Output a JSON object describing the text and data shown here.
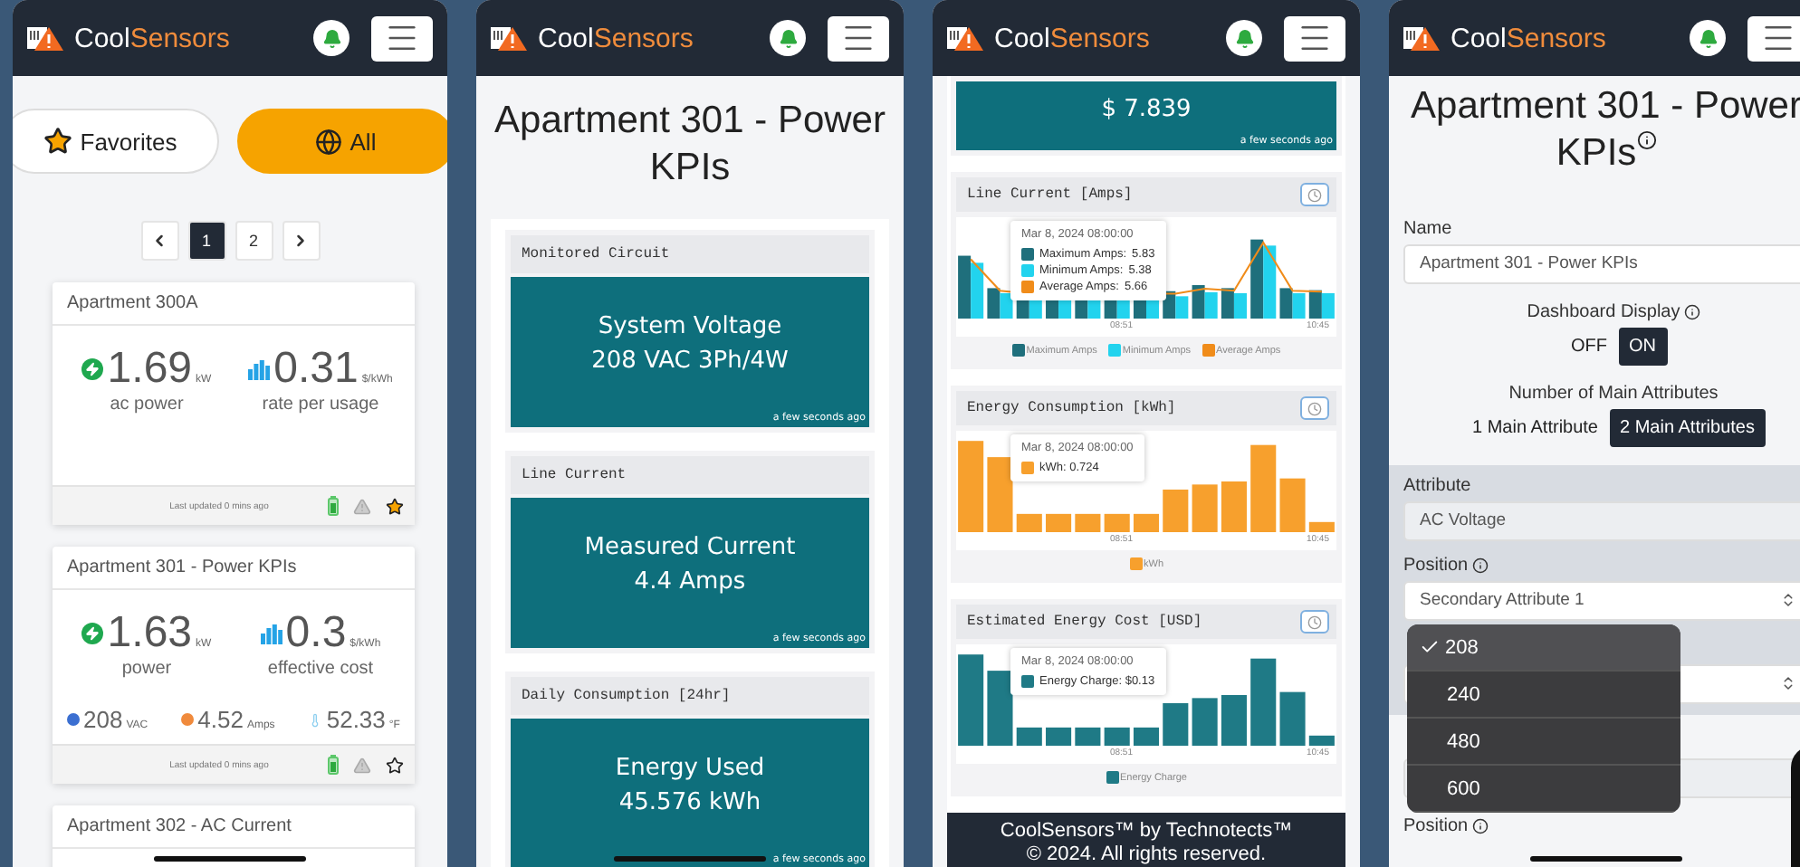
{
  "screens": [
    {
      "kind": "device_list",
      "header": {
        "brand_first": "Cool",
        "brand_second": "Sensors"
      },
      "filters": [
        {
          "label": "Favorites",
          "selected": false
        },
        {
          "label": "All",
          "selected": true
        }
      ],
      "pages": [
        {
          "label": "1",
          "selected": true
        },
        {
          "label": "2",
          "selected": false
        }
      ],
      "cards": [
        {
          "title": "Apartment 300A",
          "metrics": [
            {
              "kind": "power",
              "value": "1.69",
              "unit": "kW",
              "label": "ac power"
            },
            {
              "kind": "rate",
              "value": "0.31",
              "unit": "$/kWh",
              "label": "rate per usage"
            }
          ],
          "updated": "Last updated 0 mins ago",
          "favorite": true
        },
        {
          "title": "Apartment 301 - Power KPIs",
          "metrics": [
            {
              "kind": "power",
              "value": "1.63",
              "unit": "kW",
              "label": "power"
            },
            {
              "kind": "rate",
              "value": "0.3",
              "unit": "$/kWh",
              "label": "effective cost"
            }
          ],
          "secondary": [
            {
              "kind": "voltage",
              "value": "208",
              "unit": "VAC"
            },
            {
              "kind": "current",
              "value": "4.52",
              "unit": "Amps"
            },
            {
              "kind": "temperature",
              "value": "52.33",
              "unit": "°F"
            }
          ],
          "updated": "Last updated 0 mins ago",
          "favorite": false
        },
        {
          "title": "Apartment 302 - AC Current"
        }
      ]
    },
    {
      "kind": "widget_list",
      "header": {
        "brand_first": "Cool",
        "brand_second": "Sensors"
      },
      "title": "Apartment 301 - Power KPIs",
      "widgets": [
        {
          "label": "Monitored Circuit",
          "name": "System Voltage",
          "value": "208 VAC 3Ph/4W",
          "updated": "a few seconds ago"
        },
        {
          "label": "Line Current",
          "name": "Measured Current",
          "value": "4.4 Amps",
          "updated": "a few seconds ago"
        },
        {
          "label": "Daily Consumption [24hr]",
          "name": "Energy Used",
          "value": "45.576 kWh",
          "updated": "a few seconds ago"
        }
      ]
    },
    {
      "kind": "charts",
      "header": {
        "brand_first": "Cool",
        "brand_second": "Sensors"
      },
      "top_widget": {
        "value": "$ 7.839",
        "updated": "a few seconds ago"
      },
      "charts": [
        {
          "kind": "grouped",
          "title": "Line Current [Amps]",
          "tooltip": {
            "date": "Mar 8, 2024 08:00:00",
            "rows": [
              {
                "label": "Maximum Amps:",
                "value": "5.83",
                "color": "#1f6f7c"
              },
              {
                "label": "Minimum Amps:",
                "value": "5.38",
                "color": "#22d3ee"
              },
              {
                "label": "Average Amps:",
                "value": "5.66",
                "color": "#f08c1a"
              }
            ]
          },
          "x_labels": [
            "08:51",
            "10:45"
          ],
          "legend": [
            {
              "label": "Maximum Amps",
              "color": "#1f6f7c"
            },
            {
              "label": "Minimum Amps",
              "color": "#22d3ee"
            },
            {
              "label": "Average Amps",
              "color": "#f08c1a"
            }
          ]
        },
        {
          "kind": "single",
          "title": "Energy Consumption [kWh]",
          "tooltip": {
            "date": "Mar 8, 2024 08:00:00",
            "rows": [
              {
                "label": "kWh: 0.724",
                "color": "#f7a02d"
              }
            ]
          },
          "x_labels": [
            "08:51",
            "10:45"
          ],
          "legend": [
            {
              "label": "kWh",
              "color": "#f7a02d"
            }
          ]
        },
        {
          "kind": "single",
          "title": "Estimated Energy Cost [USD]",
          "tooltip": {
            "date": "Mar 8, 2024 08:00:00",
            "rows": [
              {
                "label": "Energy Charge: $0.13",
                "color": "#1f7a86"
              }
            ]
          },
          "x_labels": [
            "08:51",
            "10:45"
          ],
          "legend": [
            {
              "label": "Energy Charge",
              "color": "#1f7a86"
            }
          ]
        }
      ],
      "footer": [
        "CoolSensors™ by Technotects™",
        "© 2024. All rights reserved."
      ]
    },
    {
      "kind": "settings",
      "header": {
        "brand_first": "Cool",
        "brand_second": "Sensors"
      },
      "title": "Apartment 301 - Power KPIs",
      "name_label": "Name",
      "name_value": "Apartment 301 - Power KPIs",
      "display_label": "Dashboard Display",
      "display_options": [
        {
          "label": "OFF",
          "selected": false
        },
        {
          "label": "ON",
          "selected": true
        }
      ],
      "count_label": "Number of Main Attributes",
      "count_options": [
        {
          "label": "1 Main Attribute",
          "selected": false
        },
        {
          "label": "2 Main Attributes",
          "selected": true
        }
      ],
      "attribute_label": "Attribute",
      "attribute_value": "AC Voltage",
      "position_label": "Position",
      "position_value": "Secondary Attribute 1",
      "dropdown_options": [
        {
          "label": "208",
          "selected": true
        },
        {
          "label": "240",
          "selected": false
        },
        {
          "label": "480",
          "selected": false
        },
        {
          "label": "600",
          "selected": false
        }
      ],
      "position_label_2": "Position"
    }
  ]
}
